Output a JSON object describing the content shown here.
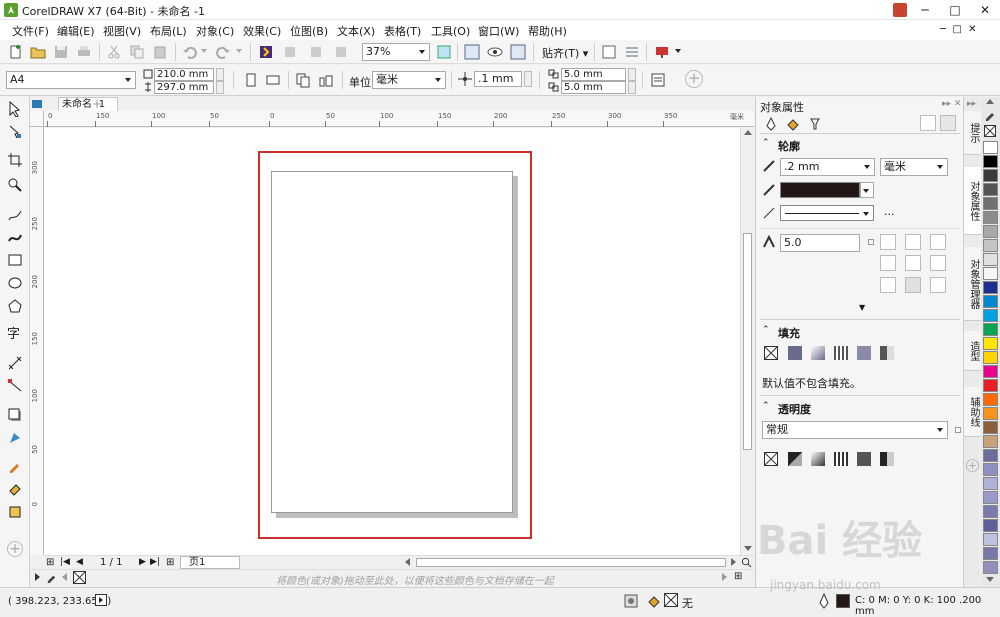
{
  "window": {
    "title": "CorelDRAW X7 (64-Bit) - 未命名 -1"
  },
  "menu": [
    "文件(F)",
    "编辑(E)",
    "视图(V)",
    "布局(L)",
    "对象(C)",
    "效果(C)",
    "位图(B)",
    "文本(X)",
    "表格(T)",
    "工具(O)",
    "窗口(W)",
    "帮助(H)"
  ],
  "toolbar": {
    "zoom": "37%",
    "snap_label": "贴齐(T)"
  },
  "property_bar": {
    "page_size": "A4",
    "width": "210.0 mm",
    "height": "297.0 mm",
    "unit_label": "单位:",
    "unit": "毫米",
    "nudge": ".1 mm",
    "dup_x": "5.0 mm",
    "dup_y": "5.0 mm"
  },
  "document": {
    "tab": "未命名 -1"
  },
  "ruler": {
    "h_ticks": [
      "0",
      "150",
      "100",
      "50",
      "0",
      "50",
      "100",
      "150",
      "200",
      "250",
      "300",
      "350"
    ],
    "v_ticks": [
      "300",
      "250",
      "200",
      "150",
      "100",
      "50",
      "0"
    ],
    "h_unit": "毫米"
  },
  "page_nav": {
    "pages": "1 / 1",
    "page_tab": "页1"
  },
  "palette_hint": "将颜色(或对象)拖动至此处，以便将这些颜色与文档存储在一起",
  "status": {
    "coords": "( 398.223, 233.652 )",
    "fill_none": "无",
    "outline_info": "C: 0 M: 0 Y: 0 K: 100  .200 mm"
  },
  "docker": {
    "title": "对象属性",
    "outline": {
      "label": "轮廓",
      "width": ".2 mm",
      "unit": "毫米",
      "dots": "...",
      "miter": "5.0"
    },
    "fill": {
      "label": "填充",
      "note": "默认值不包含填充。"
    },
    "transparency": {
      "label": "透明度",
      "mode": "常规"
    }
  },
  "side_tabs": [
    "提示",
    "对象属性",
    "对象管理器",
    "造型",
    "辅助线"
  ],
  "palette_colors": [
    "#ffffff",
    "#000000",
    "#3a3a3a",
    "#555555",
    "#707070",
    "#8c8c8c",
    "#a8a8a8",
    "#c4c4c4",
    "#e0e0e0",
    "#f5f5f5",
    "#1f2f8f",
    "#0088cc",
    "#00a0e0",
    "#00a651",
    "#ffe600",
    "#ffd400",
    "#ec008c",
    "#ed1c24",
    "#ff6a00",
    "#f7941d",
    "#8b5e3c",
    "#c8a27a",
    "#6b6b9c",
    "#8f8fc0",
    "#b0b0d8",
    "#9999cc",
    "#7a7ab0",
    "#5f5f99",
    "#c0c0e0",
    "#7777aa",
    "#9090bb"
  ],
  "watermark": {
    "main": "Bai 经验",
    "sub": "jingyan.baidu.com"
  }
}
